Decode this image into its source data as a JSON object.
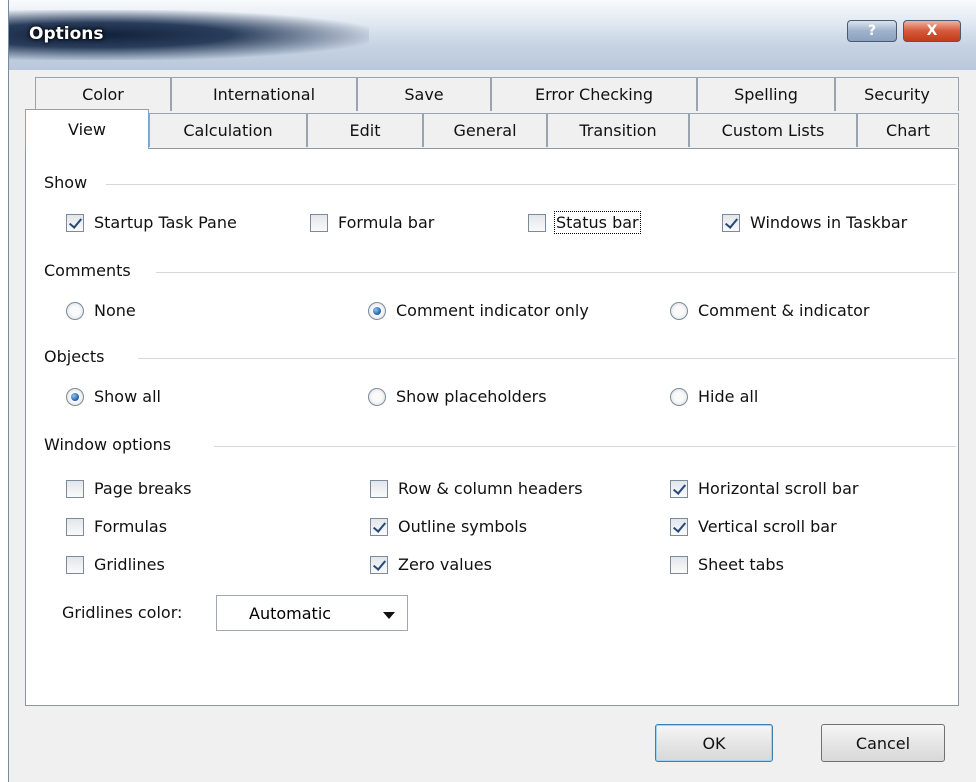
{
  "window": {
    "title": "Options",
    "help_label": "?",
    "close_label": "X"
  },
  "tabs_back": [
    "Color",
    "International",
    "Save",
    "Error Checking",
    "Spelling",
    "Security"
  ],
  "tabs_front": [
    "View",
    "Calculation",
    "Edit",
    "General",
    "Transition",
    "Custom Lists",
    "Chart"
  ],
  "active_tab": "View",
  "show": {
    "label": "Show",
    "items": [
      {
        "label": "Startup Task Pane",
        "checked": true
      },
      {
        "label": "Formula bar",
        "checked": false
      },
      {
        "label": "Status bar",
        "checked": false
      },
      {
        "label": "Windows in Taskbar",
        "checked": true
      }
    ]
  },
  "comments": {
    "label": "Comments",
    "items": [
      {
        "label": "None",
        "selected": false
      },
      {
        "label": "Comment indicator only",
        "selected": true
      },
      {
        "label": "Comment & indicator",
        "selected": false
      }
    ]
  },
  "objects": {
    "label": "Objects",
    "items": [
      {
        "label": "Show all",
        "selected": true
      },
      {
        "label": "Show placeholders",
        "selected": false
      },
      {
        "label": "Hide all",
        "selected": false
      }
    ]
  },
  "window_options": {
    "label": "Window options",
    "items": [
      {
        "label": "Page breaks",
        "checked": false
      },
      {
        "label": "Row & column headers",
        "checked": false
      },
      {
        "label": "Horizontal scroll bar",
        "checked": true
      },
      {
        "label": "Formulas",
        "checked": false
      },
      {
        "label": "Outline symbols",
        "checked": true
      },
      {
        "label": "Vertical scroll bar",
        "checked": true
      },
      {
        "label": "Gridlines",
        "checked": false
      },
      {
        "label": "Zero values",
        "checked": true
      },
      {
        "label": "Sheet tabs",
        "checked": false
      }
    ],
    "gridlines_color_label": "Gridlines color:",
    "gridlines_color_value": "Automatic"
  },
  "buttons": {
    "ok": "OK",
    "cancel": "Cancel"
  }
}
